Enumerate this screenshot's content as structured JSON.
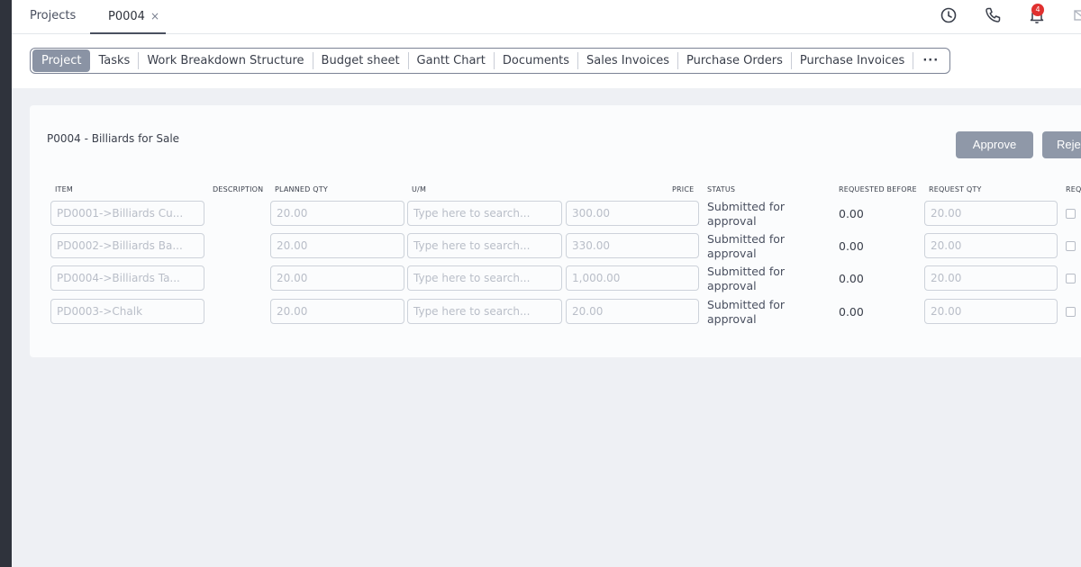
{
  "topbar": {
    "tabs": [
      {
        "label": "Projects"
      },
      {
        "label": "P0004",
        "close": "×"
      }
    ],
    "notification_count": "4"
  },
  "nav": {
    "tabs": [
      "Project",
      "Tasks",
      "Work Breakdown Structure",
      "Budget sheet",
      "Gantt Chart",
      "Documents",
      "Sales Invoices",
      "Purchase Orders",
      "Purchase Invoices"
    ],
    "more": "···"
  },
  "card": {
    "title": "P0004 - Billiards for Sale",
    "approve_label": "Approve",
    "reject_label": "Reje"
  },
  "columns": {
    "item": "ITEM",
    "description": "DESCRIPTION",
    "planned_qty": "PLANNED QTY",
    "um": "U/M",
    "price": "PRICE",
    "status": "STATUS",
    "requested_before": "REQUESTED BEFORE",
    "request_qty": "REQUEST QTY",
    "req": "REQ"
  },
  "rows": [
    {
      "item": "PD0001->Billiards Cu...",
      "planned_qty": "20.00",
      "um_placeholder": "Type here to search...",
      "price": "300.00",
      "status": "Submitted for approval",
      "requested_before": "0.00",
      "request_qty": "20.00"
    },
    {
      "item": "PD0002->Billiards Ba...",
      "planned_qty": "20.00",
      "um_placeholder": "Type here to search...",
      "price": "330.00",
      "status": "Submitted for approval",
      "requested_before": "0.00",
      "request_qty": "20.00"
    },
    {
      "item": "PD0004->Billiards Ta...",
      "planned_qty": "20.00",
      "um_placeholder": "Type here to search...",
      "price": "1,000.00",
      "status": "Submitted for approval",
      "requested_before": "0.00",
      "request_qty": "20.00"
    },
    {
      "item": "PD0003->Chalk",
      "planned_qty": "20.00",
      "um_placeholder": "Type here to search...",
      "price": "20.00",
      "status": "Submitted for approval",
      "requested_before": "0.00",
      "request_qty": "20.00"
    }
  ],
  "icons": {
    "history": "clock-icon",
    "phone": "phone-icon",
    "notifications": "bell-icon",
    "mail": "mail-icon"
  }
}
